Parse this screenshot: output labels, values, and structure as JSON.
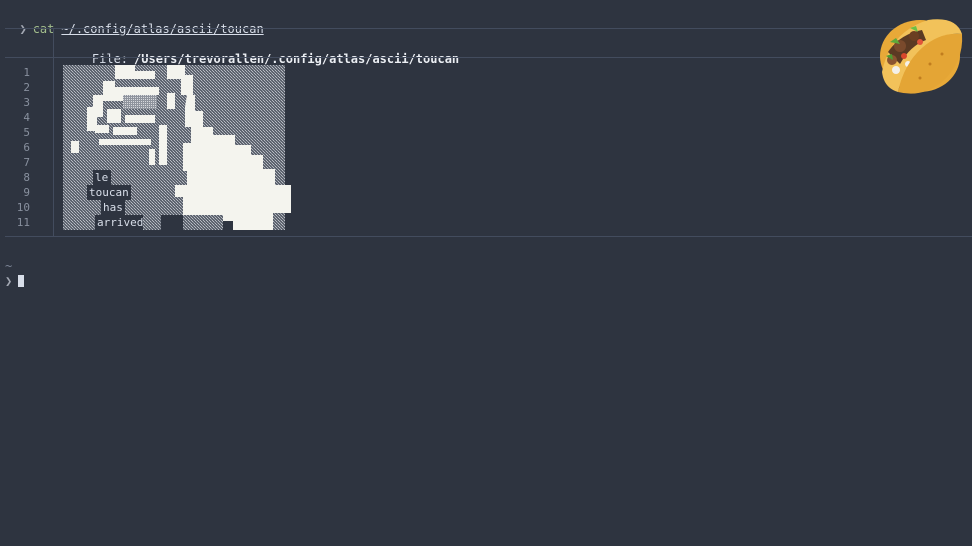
{
  "terminal": {
    "prompt_symbol": "❯",
    "command": "cat",
    "argument": "~/.config/atlas/ascii/toucan",
    "next_prompt_tilde": "~",
    "next_prompt_symbol": "❯"
  },
  "bat": {
    "file_label": "File:",
    "file_path": "/Users/trevorallen/.config/atlas/ascii/toucan",
    "line_numbers": [
      "1",
      "2",
      "3",
      "4",
      "5",
      "6",
      "7",
      "8",
      "9",
      "10",
      "11"
    ],
    "text_lines": {
      "line8": "le",
      "line9": "toucan",
      "line10": "has",
      "line11": "arrived"
    }
  },
  "decor": {
    "taco_icon": "taco-emoji"
  },
  "colors": {
    "background": "#2e3440",
    "foreground": "#d8dee9",
    "accent_command": "#a3be8c",
    "art_white": "#f4f4ee",
    "shade": "#8a8f98"
  }
}
